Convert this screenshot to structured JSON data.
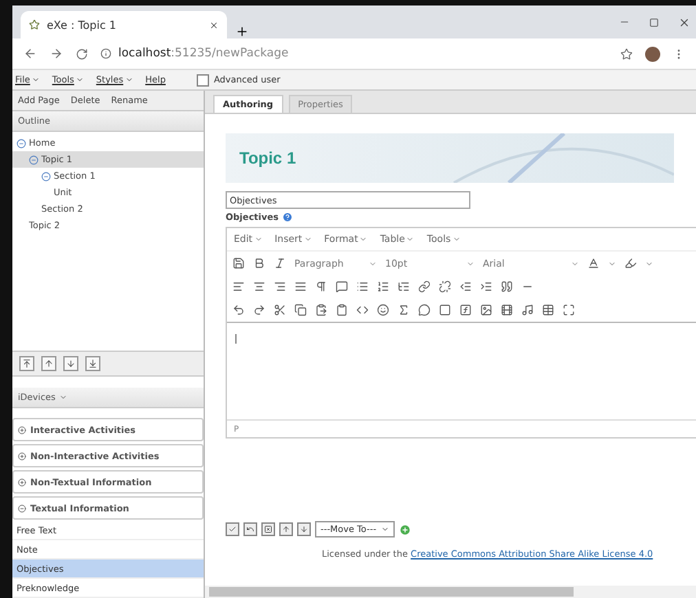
{
  "browser": {
    "tab_title": "eXe : Topic 1",
    "address_host": "localhost",
    "address_path": ":51235/newPackage"
  },
  "menu": [
    {
      "label": "File",
      "dropdown": true
    },
    {
      "label": "Tools",
      "dropdown": true
    },
    {
      "label": "Styles",
      "dropdown": true
    },
    {
      "label": "Help",
      "dropdown": false
    }
  ],
  "advanced_user": {
    "label": "Advanced user",
    "checked": false
  },
  "outline_toolbar": [
    "Add Page",
    "Delete",
    "Rename"
  ],
  "outline": {
    "title": "Outline",
    "tree": [
      {
        "label": "Home",
        "expanded": true,
        "selected": false,
        "children": [
          {
            "label": "Topic 1",
            "expanded": true,
            "selected": true,
            "children": [
              {
                "label": "Section 1",
                "expanded": true,
                "selected": false,
                "children": [
                  {
                    "label": "Unit",
                    "selected": false
                  }
                ]
              },
              {
                "label": "Section 2",
                "selected": false
              }
            ]
          },
          {
            "label": "Topic 2",
            "selected": false
          }
        ]
      }
    ]
  },
  "idevices": {
    "title": "iDevices",
    "categories": [
      {
        "label": "Interactive Activities",
        "expanded": false
      },
      {
        "label": "Non-Interactive Activities",
        "expanded": false
      },
      {
        "label": "Non-Textual Information",
        "expanded": false
      },
      {
        "label": "Textual Information",
        "expanded": true,
        "items": [
          {
            "label": "Free Text",
            "selected": false
          },
          {
            "label": "Note",
            "selected": false
          },
          {
            "label": "Objectives",
            "selected": true
          },
          {
            "label": "Preknowledge",
            "selected": false
          }
        ]
      }
    ]
  },
  "tabs": [
    {
      "label": "Authoring",
      "selected": true
    },
    {
      "label": "Properties",
      "selected": false
    }
  ],
  "page_title": "Topic 1",
  "idevice_title_value": "Objectives",
  "idevice_label": "Objectives",
  "editor": {
    "menus": [
      "Edit",
      "Insert",
      "Format",
      "Table",
      "Tools"
    ],
    "block_format": "Paragraph",
    "font_size": "10pt",
    "font_family": "Arial",
    "status_path": "P"
  },
  "move_to": "---Move To---",
  "license": {
    "prefix": "Licensed under the ",
    "link": "Creative Commons Attribution Share Alike License 4.0"
  }
}
